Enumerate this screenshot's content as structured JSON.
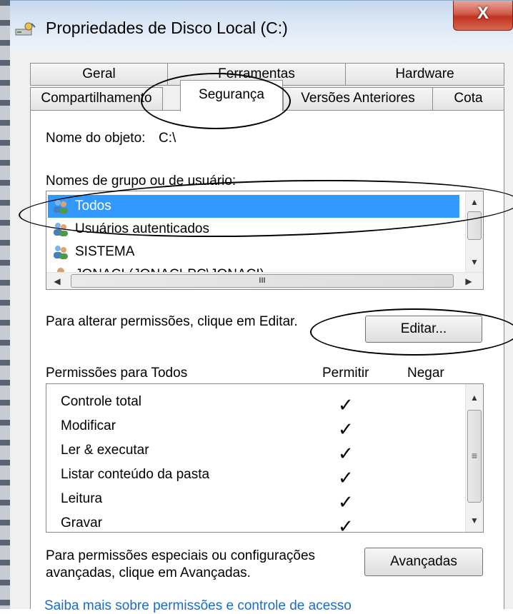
{
  "window": {
    "title": "Propriedades de Disco Local (C:)",
    "close_label": "X"
  },
  "tabs_row1": [
    {
      "label": "Geral"
    },
    {
      "label": "Ferramentas"
    },
    {
      "label": "Hardware"
    }
  ],
  "tabs_row2": [
    {
      "label": "Compartilhamento"
    },
    {
      "label": "Segurança",
      "active": true
    },
    {
      "label": "Versões Anteriores"
    },
    {
      "label": "Cota"
    }
  ],
  "object": {
    "label": "Nome do objeto:",
    "value": "C:\\"
  },
  "groups": {
    "label": "Nomes de grupo ou de usuário:",
    "items": [
      {
        "name": "Todos",
        "selected": true,
        "icon": "users-group-icon"
      },
      {
        "name": "Usuários autenticados",
        "icon": "users-group-icon"
      },
      {
        "name": "SISTEMA",
        "icon": "users-group-icon"
      },
      {
        "name": "JONACI (JONACI-PC\\JONACI)",
        "icon": "user-icon"
      }
    ],
    "hscroll_grip": "III"
  },
  "edit": {
    "hint": "Para alterar permissões, clique em Editar.",
    "button_label": "Editar..."
  },
  "permissions": {
    "title": "Permissões para Todos",
    "allow_header": "Permitir",
    "deny_header": "Negar",
    "check_glyph": "✓",
    "rows": [
      {
        "name": "Controle total",
        "allow": true,
        "deny": false
      },
      {
        "name": "Modificar",
        "allow": true,
        "deny": false
      },
      {
        "name": "Ler & executar",
        "allow": true,
        "deny": false
      },
      {
        "name": "Listar conteúdo da pasta",
        "allow": true,
        "deny": false
      },
      {
        "name": "Leitura",
        "allow": true,
        "deny": false
      },
      {
        "name": "Gravar",
        "allow": true,
        "deny": false
      }
    ]
  },
  "advanced": {
    "hint_line1": "Para permissões especiais ou configurações",
    "hint_line2": "avançadas, clique em Avançadas.",
    "button_label": "Avançadas"
  },
  "link": {
    "text": "Saiba mais sobre permissões e controle de acesso"
  },
  "scroll_glyphs": {
    "up": "▲",
    "down": "▼",
    "left": "◀",
    "right": "▶",
    "grip": "≡"
  }
}
